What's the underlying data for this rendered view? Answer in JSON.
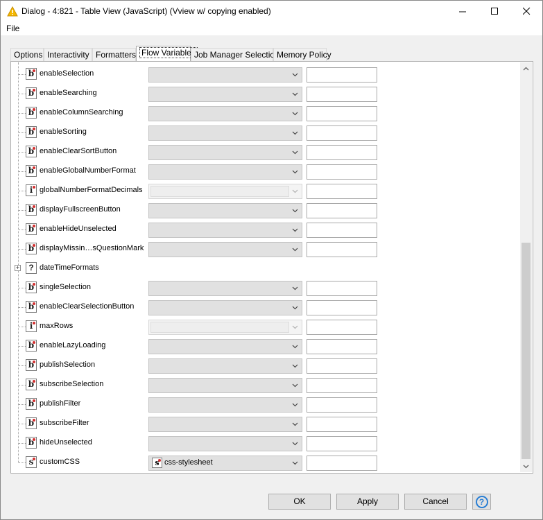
{
  "window": {
    "title": "Dialog - 4:821 - Table View (JavaScript) (Vview w/ copying enabled)",
    "minimize": "—",
    "maximize": "☐",
    "close": "✕"
  },
  "menu": {
    "file": "File"
  },
  "tabs": [
    {
      "label": "Options",
      "active": false
    },
    {
      "label": "Interactivity",
      "active": false
    },
    {
      "label": "Formatters",
      "active": false
    },
    {
      "label": "Flow Variables",
      "active": true
    },
    {
      "label": "Job Manager Selection",
      "active": false
    },
    {
      "label": "Memory Policy",
      "active": false
    }
  ],
  "rows": [
    {
      "type": "b",
      "label": "enableSelection",
      "combo": "normal",
      "value": ""
    },
    {
      "type": "b",
      "label": "enableSearching",
      "combo": "normal",
      "value": ""
    },
    {
      "type": "b",
      "label": "enableColumnSearching",
      "combo": "normal",
      "value": ""
    },
    {
      "type": "b",
      "label": "enableSorting",
      "combo": "normal",
      "value": ""
    },
    {
      "type": "b",
      "label": "enableClearSortButton",
      "combo": "normal",
      "value": ""
    },
    {
      "type": "b",
      "label": "enableGlobalNumberFormat",
      "combo": "normal",
      "value": ""
    },
    {
      "type": "i",
      "label": "globalNumberFormatDecimals",
      "combo": "disabled",
      "value": ""
    },
    {
      "type": "b",
      "label": "displayFullscreenButton",
      "combo": "normal",
      "value": ""
    },
    {
      "type": "b",
      "label": "enableHideUnselected",
      "combo": "normal",
      "value": ""
    },
    {
      "type": "b",
      "label": "displayMissin…sQuestionMark",
      "combo": "normal",
      "value": ""
    },
    {
      "type": "?",
      "label": "dateTimeFormats",
      "combo": "none",
      "value": "",
      "expander": "+"
    },
    {
      "type": "b",
      "label": "singleSelection",
      "combo": "normal",
      "value": ""
    },
    {
      "type": "b",
      "label": "enableClearSelectionButton",
      "combo": "normal",
      "value": ""
    },
    {
      "type": "i",
      "label": "maxRows",
      "combo": "disabled",
      "value": ""
    },
    {
      "type": "b",
      "label": "enableLazyLoading",
      "combo": "normal",
      "value": ""
    },
    {
      "type": "b",
      "label": "publishSelection",
      "combo": "normal",
      "value": ""
    },
    {
      "type": "b",
      "label": "subscribeSelection",
      "combo": "normal",
      "value": ""
    },
    {
      "type": "b",
      "label": "publishFilter",
      "combo": "normal",
      "value": ""
    },
    {
      "type": "b",
      "label": "subscribeFilter",
      "combo": "normal",
      "value": ""
    },
    {
      "type": "b",
      "label": "hideUnselected",
      "combo": "normal",
      "value": ""
    },
    {
      "type": "s",
      "label": "customCSS",
      "combo": "normal",
      "value": "css-stylesheet",
      "combo_icon": "s"
    }
  ],
  "buttons": {
    "ok": "OK",
    "apply": "Apply",
    "cancel": "Cancel",
    "help": "?"
  },
  "colors": {
    "accent": "#2a7fd4",
    "variable_dot": "#d32f2f",
    "warning": "#f5b800"
  }
}
